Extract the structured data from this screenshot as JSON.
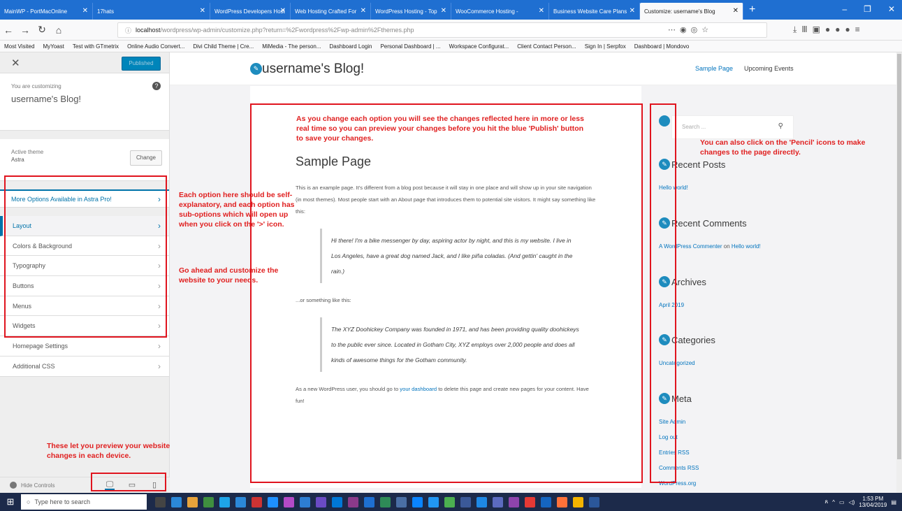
{
  "browser": {
    "tabs": [
      "MainWP - PortMacOnline",
      "17hats",
      "WordPress Developers Host",
      "Web Hosting Crafted For",
      "WordPress Hosting - Top",
      "WooCommerce Hosting -",
      "Business Website Care Plans",
      "Customize: username's Blog"
    ],
    "url_host": "localhost",
    "url_path": "/wordpress/wp-admin/customize.php?return=%2Fwordpress%2Fwp-admin%2Fthemes.php",
    "bookmarks": [
      "Most Visited",
      "MyYoast",
      "Test with GTmetrix",
      "Online Audio Convert...",
      "Divi Child Theme | Cre...",
      "MiMedia - The person...",
      "Dashboard Login",
      "Personal Dashboard | ...",
      "Workspace Configurat...",
      "Client Contact Person...",
      "Sign In | Serpfox",
      "Dashboard | Mondovo"
    ]
  },
  "customizer": {
    "publish_label": "Published",
    "customizing_label": "You are customizing",
    "site_name": "username's Blog!",
    "active_theme_label": "Active theme",
    "theme_name": "Astra",
    "change_label": "Change",
    "more_options": "More Options Available in Astra Pro!",
    "menu": [
      "Layout",
      "Colors & Background",
      "Typography",
      "Buttons",
      "Menus",
      "Widgets",
      "Homepage Settings",
      "Additional CSS"
    ],
    "hide_controls": "Hide Controls"
  },
  "preview": {
    "site_title": "username's Blog!",
    "nav": [
      "Sample Page",
      "Upcoming Events"
    ],
    "page_title": "Sample Page",
    "intro": "This is an example page. It's different from a blog post because it will stay in one place and will show up in your site navigation (in most themes). Most people start with an About page that introduces them to potential site visitors. It might say something like this:",
    "quote1": "Hi there! I'm a bike messenger by day, aspiring actor by night, and this is my website. I live in Los Angeles, have a great dog named Jack, and I like piña coladas. (And gettin' caught in the rain.)",
    "middle": "...or something like this:",
    "quote2": "The XYZ Doohickey Company was founded in 1971, and has been providing quality doohickeys to the public ever since. Located in Gotham City, XYZ employs over 2,000 people and does all kinds of awesome things for the Gotham community.",
    "outro_before": "As a new WordPress user, you should go to ",
    "outro_link": "your dashboard",
    "outro_after": " to delete this page and create new pages for your content. Have fun!",
    "search_placeholder": "Search ...",
    "widgets": {
      "recent_posts": "Recent Posts",
      "post1": "Hello world!",
      "recent_comments": "Recent Comments",
      "commenter": "A WordPress Commenter",
      "on": " on ",
      "comment_post": "Hello world!",
      "archives": "Archives",
      "archive1": "April 2019",
      "categories": "Categories",
      "cat1": "Uncategorized",
      "meta": "Meta",
      "meta_links": [
        "Site Admin",
        "Log out",
        "Entries RSS",
        "Comments RSS",
        "WordPress.org"
      ]
    }
  },
  "annotations": {
    "center": "As you change each option you will see the changes reflected here in more or less real time so you can preview your changes before you hit the blue 'Publish' button to save your changes.",
    "pencil": "You can also click on the 'Pencil' icons to make changes to the page directly.",
    "options": "Each option here should be self-explanatory, and each option has sub-options which will open up when you click on the '>' icon.",
    "customize": "Go ahead and customize the website to your needs.",
    "devices": "These let you preview your website changes in each device."
  },
  "taskbar": {
    "search_placeholder": "Type here to search",
    "time": "1:53 PM",
    "date": "13/04/2019"
  }
}
